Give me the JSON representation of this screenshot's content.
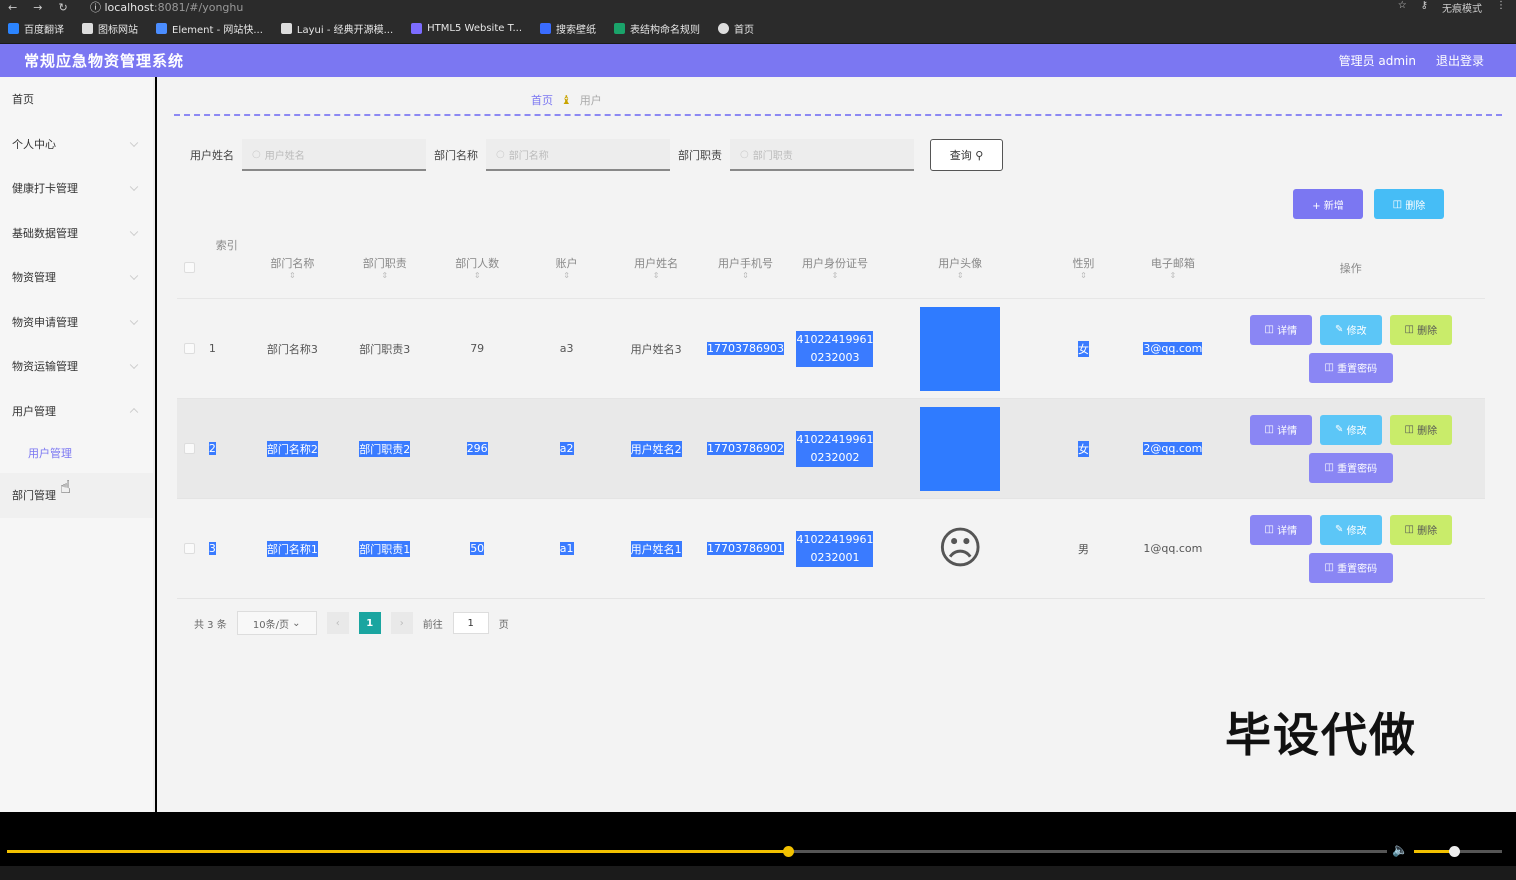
{
  "browser": {
    "url_host": "localhost",
    "url_rest": ":8081/#/yonghu",
    "mode_label": "无痕模式",
    "bookmarks": [
      "百度翻译",
      "图标网站",
      "Element - 网站快...",
      "Layui - 经典开源模...",
      "HTML5 Website T...",
      "搜索壁纸",
      "表结构命名规则",
      "首页"
    ],
    "bookmark_colors": [
      "#2b84ff",
      "#ffffff",
      "#4b8dff",
      "#ffffff",
      "#7c6cff",
      "#3a6cff",
      "#1aa36a",
      "#ffffff"
    ]
  },
  "header": {
    "title": "常规应急物资管理系统",
    "user": "管理员 admin",
    "logout": "退出登录"
  },
  "sidebar": {
    "items": [
      "首页",
      "个人中心",
      "健康打卡管理",
      "基础数据管理",
      "物资管理",
      "物资申请管理",
      "物资运输管理",
      "用户管理"
    ],
    "sub_item": "用户管理",
    "last_item": "部门管理"
  },
  "breadcrumb": {
    "home": "首页",
    "current": "用户"
  },
  "search": {
    "label1": "用户姓名",
    "placeholder1": "用户姓名",
    "label2": "部门名称",
    "placeholder2": "部门名称",
    "label3": "部门职责",
    "placeholder3": "部门职责",
    "query": "查询"
  },
  "actions": {
    "add": "+ 新增",
    "delete": "删除"
  },
  "table": {
    "headers": {
      "index": "索引",
      "dept_name": "部门名称",
      "dept_duty": "部门职责",
      "dept_count": "部门人数",
      "account": "账户",
      "user_name": "用户姓名",
      "phone": "用户手机号",
      "id_no": "用户身份证号",
      "avatar": "用户头像",
      "sex": "性别",
      "email": "电子邮箱",
      "ops": "操作"
    },
    "rows": [
      {
        "index": "1",
        "dept_name": "部门名称3",
        "dept_duty": "部门职责3",
        "dept_count": "79",
        "account": "a3",
        "user_name": "用户姓名3",
        "phone": "17703786903",
        "id_no_1": "41022419961",
        "id_no_2": "0232003",
        "sex": "女",
        "email": "3@qq.com"
      },
      {
        "index": "2",
        "dept_name": "部门名称2",
        "dept_duty": "部门职责2",
        "dept_count": "296",
        "account": "a2",
        "user_name": "用户姓名2",
        "phone": "17703786902",
        "id_no_1": "41022419961",
        "id_no_2": "0232002",
        "sex": "女",
        "email": "2@qq.com"
      },
      {
        "index": "3",
        "dept_name": "部门名称1",
        "dept_duty": "部门职责1",
        "dept_count": "50",
        "account": "a1",
        "user_name": "用户姓名1",
        "phone": "17703786901",
        "id_no_1": "41022419961",
        "id_no_2": "0232001",
        "sex": "男",
        "email": "1@qq.com"
      }
    ],
    "ops": {
      "detail": "详情",
      "edit": "修改",
      "delete": "删除",
      "reset": "重置密码"
    }
  },
  "pager": {
    "total": "共 3 条",
    "page_size": "10条/页",
    "current": "1",
    "goto": "前往",
    "goto_value": "1",
    "page_unit": "页"
  },
  "watermark": "毕设代做",
  "video": {
    "progress": 0.566,
    "volume": 0.45
  }
}
